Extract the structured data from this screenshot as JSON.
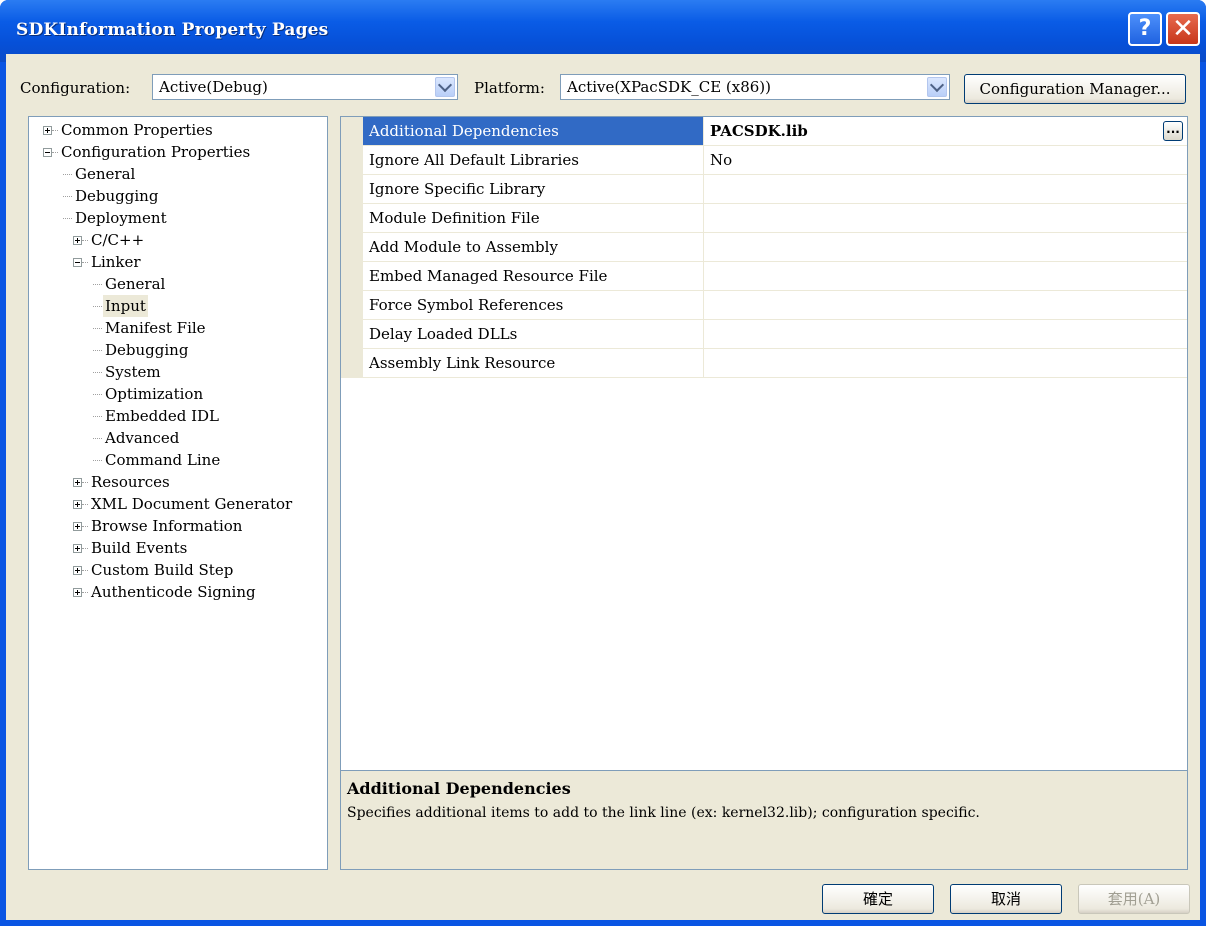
{
  "window": {
    "title": "SDKInformation Property Pages",
    "help_glyph": "?",
    "close_glyph": "✕"
  },
  "config": {
    "configuration_label": "Configuration:",
    "configuration_value": "Active(Debug)",
    "platform_label": "Platform:",
    "platform_value": "Active(XPacSDK_CE (x86))",
    "manager_label": "Configuration Manager..."
  },
  "tree": [
    {
      "label": "Common Properties",
      "level": 0,
      "expander": "plus"
    },
    {
      "label": "Configuration Properties",
      "level": 0,
      "expander": "minus"
    },
    {
      "label": "General",
      "level": 1
    },
    {
      "label": "Debugging",
      "level": 1
    },
    {
      "label": "Deployment",
      "level": 1
    },
    {
      "label": "C/C++",
      "level": 1,
      "expander": "plus"
    },
    {
      "label": "Linker",
      "level": 1,
      "expander": "minus"
    },
    {
      "label": "General",
      "level": 2
    },
    {
      "label": "Input",
      "level": 2,
      "selected": true
    },
    {
      "label": "Manifest File",
      "level": 2
    },
    {
      "label": "Debugging",
      "level": 2
    },
    {
      "label": "System",
      "level": 2
    },
    {
      "label": "Optimization",
      "level": 2
    },
    {
      "label": "Embedded IDL",
      "level": 2
    },
    {
      "label": "Advanced",
      "level": 2
    },
    {
      "label": "Command Line",
      "level": 2
    },
    {
      "label": "Resources",
      "level": 1,
      "expander": "plus"
    },
    {
      "label": "XML Document Generator",
      "level": 1,
      "expander": "plus"
    },
    {
      "label": "Browse Information",
      "level": 1,
      "expander": "plus"
    },
    {
      "label": "Build Events",
      "level": 1,
      "expander": "plus"
    },
    {
      "label": "Custom Build Step",
      "level": 1,
      "expander": "plus"
    },
    {
      "label": "Authenticode Signing",
      "level": 1,
      "expander": "plus"
    }
  ],
  "properties": [
    {
      "name": "Additional Dependencies",
      "value": "PACSDK.lib",
      "selected": true,
      "bold": true
    },
    {
      "name": "Ignore All Default Libraries",
      "value": "No"
    },
    {
      "name": "Ignore Specific Library",
      "value": ""
    },
    {
      "name": "Module Definition File",
      "value": ""
    },
    {
      "name": "Add Module to Assembly",
      "value": ""
    },
    {
      "name": "Embed Managed Resource File",
      "value": ""
    },
    {
      "name": "Force Symbol References",
      "value": ""
    },
    {
      "name": "Delay Loaded DLLs",
      "value": ""
    },
    {
      "name": "Assembly Link Resource",
      "value": ""
    }
  ],
  "ellipsis": "...",
  "description": {
    "title": "Additional Dependencies",
    "text": "Specifies additional items to add to the link line (ex: kernel32.lib); configuration specific."
  },
  "buttons": {
    "ok": "確定",
    "cancel": "取消",
    "apply": "套用(A)"
  }
}
